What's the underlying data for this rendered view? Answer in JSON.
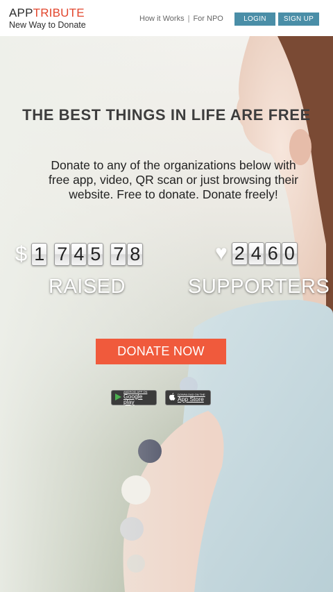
{
  "header": {
    "brand_app": "APP",
    "brand_tribute": "TRIBUTE",
    "tagline": "New Way to Donate",
    "nav": [
      {
        "label": "How it Works"
      },
      {
        "label": "For NPO"
      }
    ],
    "nav_separator": "|",
    "login_label": "LOGIN",
    "signup_label": "SIGN UP"
  },
  "hero": {
    "headline": "THE BEST THINGS IN LIFE ARE FREE",
    "subtext": "Donate to any of the organizations below with free app, video, QR scan or just browsing their website. Free to donate. Donate freely!",
    "raised": {
      "symbol": "$",
      "digits": [
        "1",
        "7",
        "4",
        "5",
        "7",
        "8"
      ],
      "label": "RAISED"
    },
    "supporters": {
      "symbol": "♥",
      "digits": [
        "2",
        "4",
        "6",
        "0"
      ],
      "label": "SUPPORTERS"
    },
    "donate_label": "DONATE NOW",
    "stores": {
      "google_small": "ANDROID APP ON",
      "google_big": "Google play",
      "apple_small": "Download on the",
      "apple_big": "App Store"
    }
  },
  "colors": {
    "brand_accent": "#e2452c",
    "button_blue": "#4a8ea7",
    "donate_orange": "#f05a3c"
  },
  "icons": {
    "google_play": "play-triangle-icon",
    "apple": "apple-icon"
  }
}
